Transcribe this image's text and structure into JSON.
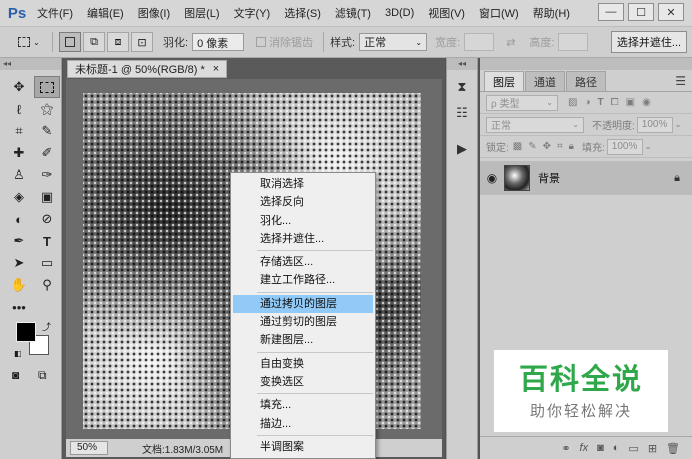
{
  "app": {
    "logo": "Ps"
  },
  "menubar": {
    "items": [
      "文件(F)",
      "编辑(E)",
      "图像(I)",
      "图层(L)",
      "文字(Y)",
      "选择(S)",
      "滤镜(T)",
      "3D(D)",
      "视图(V)",
      "窗口(W)",
      "帮助(H)"
    ],
    "window_buttons": [
      "—",
      "☐",
      "✕"
    ]
  },
  "options": {
    "feather_label": "羽化:",
    "feather_value": "0 像素",
    "antialias_label": "消除锯齿",
    "style_label": "样式:",
    "style_value": "正常",
    "width_label": "宽度:",
    "height_label": "高度:",
    "select_mask_button": "选择并遮住..."
  },
  "document": {
    "tab_title": "未标题-1 @ 50%(RGB/8) *",
    "tab_close": "×",
    "zoom": "50%",
    "doc_size": "文档:1.83M/3.05M"
  },
  "context_menu": {
    "groups": [
      [
        "取消选择",
        "选择反向",
        "羽化...",
        "选择并遮住..."
      ],
      [
        "存储选区...",
        "建立工作路径..."
      ],
      [
        "通过拷贝的图层",
        "通过剪切的图层",
        "新建图层..."
      ],
      [
        "自由变换",
        "变换选区"
      ],
      [
        "填充...",
        "描边..."
      ],
      [
        "半调图案"
      ]
    ],
    "highlighted": "通过拷贝的图层"
  },
  "layers_panel": {
    "tabs": [
      "图层",
      "通道",
      "路径"
    ],
    "kind_filter": "ρ 类型",
    "blend_mode": "正常",
    "opacity_label": "不透明度:",
    "opacity_value": "100%",
    "lock_label": "锁定:",
    "fill_label": "填充:",
    "fill_value": "100%",
    "layer_name": "背景"
  },
  "watermark": {
    "title": "百科全说",
    "subtitle": "助你轻松解决"
  },
  "colors": {
    "highlight": "#91c9f7",
    "watermark_green": "#2ea84a",
    "ps_blue": "#2b5fa8"
  }
}
